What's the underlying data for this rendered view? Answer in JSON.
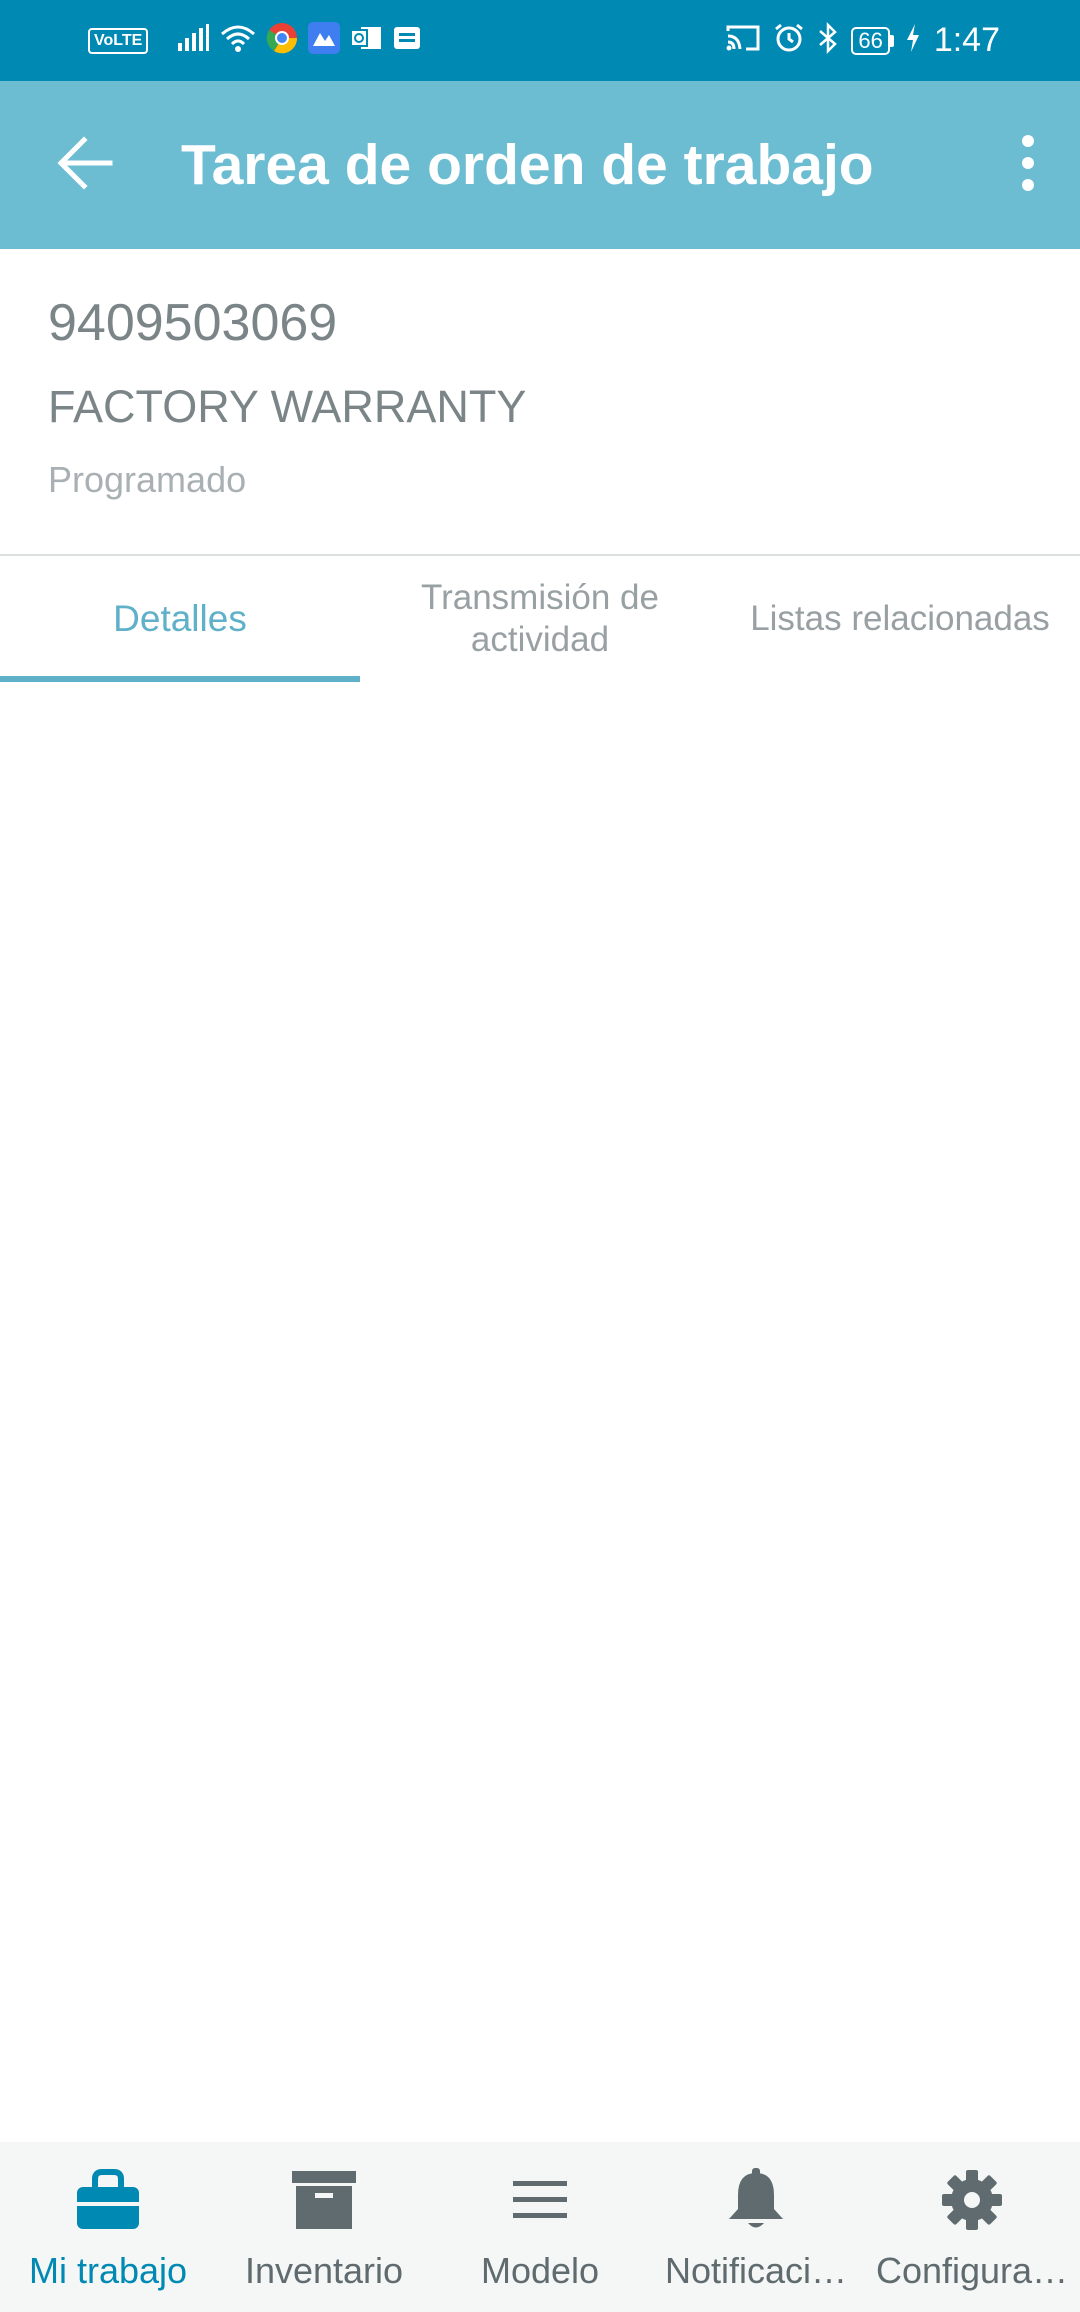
{
  "status_bar": {
    "volte": "VoLTE",
    "battery": "66",
    "time": "1:47",
    "icons": [
      "volte-icon",
      "signal-icon",
      "wifi-icon",
      "chrome-icon",
      "app-icon",
      "outlook-icon",
      "message-icon",
      "cast-icon",
      "alarm-icon",
      "bluetooth-icon",
      "battery-icon",
      "charging-icon"
    ]
  },
  "app_bar": {
    "title": "Tarea de orden de trabajo",
    "back_icon": "arrow-left-icon",
    "menu_icon": "more-vertical-icon",
    "background": "#6cbcd2"
  },
  "record": {
    "number": "9409503069",
    "type": "FACTORY WARRANTY",
    "status": "Programado"
  },
  "tabs": [
    {
      "label": "Detalles",
      "active": true
    },
    {
      "label": "Transmisión de actividad",
      "active": false
    },
    {
      "label": "Listas relacionadas",
      "active": false
    }
  ],
  "bottom_nav": [
    {
      "label": "Mi trabajo",
      "icon": "briefcase-icon",
      "active": true
    },
    {
      "label": "Inventario",
      "icon": "archive-box-icon",
      "active": false
    },
    {
      "label": "Modelo",
      "icon": "menu-lines-icon",
      "active": false
    },
    {
      "label": "Notificaci…",
      "icon": "bell-icon",
      "active": false
    },
    {
      "label": "Configura…",
      "icon": "gear-icon",
      "active": false
    }
  ],
  "colors": {
    "status_bar": "#0089b3",
    "accent": "#5fb0c9",
    "nav_active": "#0089b3"
  }
}
